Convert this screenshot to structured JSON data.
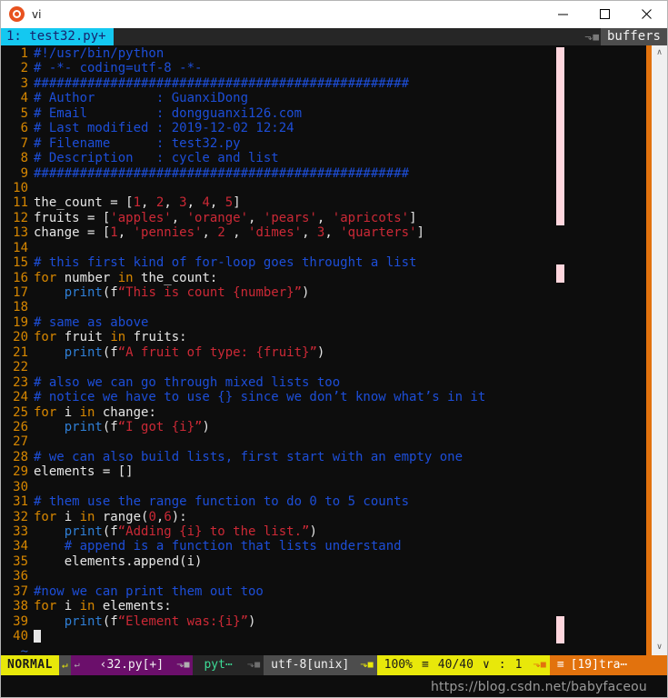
{
  "window": {
    "title": "vi",
    "app_icon": "ubuntu-icon",
    "controls": {
      "minimize": "–",
      "maximize": "□",
      "close": "✕"
    }
  },
  "tabline": {
    "active_tab": "1: test32.py+",
    "separator_glyph": "⬎■",
    "right_label": "buffers"
  },
  "editor": {
    "lines": [
      {
        "n": "1",
        "tokens": [
          {
            "t": "#!/usr/bin/python",
            "c": "c-comment"
          }
        ]
      },
      {
        "n": "2",
        "tokens": [
          {
            "t": "# -*- coding=utf-8 -*-",
            "c": "c-comment"
          }
        ]
      },
      {
        "n": "3",
        "tokens": [
          {
            "t": "#################################################",
            "c": "c-comment"
          }
        ]
      },
      {
        "n": "4",
        "tokens": [
          {
            "t": "# Author        : GuanxiDong",
            "c": "c-comment"
          }
        ]
      },
      {
        "n": "5",
        "tokens": [
          {
            "t": "# Email         : dongguanxi126.com",
            "c": "c-comment"
          }
        ]
      },
      {
        "n": "6",
        "tokens": [
          {
            "t": "# Last modified : 2019-12-02 12:24",
            "c": "c-comment"
          }
        ]
      },
      {
        "n": "7",
        "tokens": [
          {
            "t": "# Filename      : test32.py",
            "c": "c-comment"
          }
        ]
      },
      {
        "n": "8",
        "tokens": [
          {
            "t": "# Description   : cycle and list",
            "c": "c-comment"
          }
        ]
      },
      {
        "n": "9",
        "tokens": [
          {
            "t": "#################################################",
            "c": "c-comment"
          }
        ]
      },
      {
        "n": "10",
        "tokens": []
      },
      {
        "n": "11",
        "tokens": [
          {
            "t": "the_count = [",
            "c": "c-plain"
          },
          {
            "t": "1",
            "c": "c-num"
          },
          {
            "t": ", ",
            "c": "c-plain"
          },
          {
            "t": "2",
            "c": "c-num"
          },
          {
            "t": ", ",
            "c": "c-plain"
          },
          {
            "t": "3",
            "c": "c-num"
          },
          {
            "t": ", ",
            "c": "c-plain"
          },
          {
            "t": "4",
            "c": "c-num"
          },
          {
            "t": ", ",
            "c": "c-plain"
          },
          {
            "t": "5",
            "c": "c-num"
          },
          {
            "t": "]",
            "c": "c-plain"
          }
        ]
      },
      {
        "n": "12",
        "tokens": [
          {
            "t": "fruits = [",
            "c": "c-plain"
          },
          {
            "t": "'apples'",
            "c": "c-str"
          },
          {
            "t": ", ",
            "c": "c-plain"
          },
          {
            "t": "'orange'",
            "c": "c-str"
          },
          {
            "t": ", ",
            "c": "c-plain"
          },
          {
            "t": "'pears'",
            "c": "c-str"
          },
          {
            "t": ", ",
            "c": "c-plain"
          },
          {
            "t": "'apricots'",
            "c": "c-str"
          },
          {
            "t": "]",
            "c": "c-plain"
          }
        ]
      },
      {
        "n": "13",
        "tokens": [
          {
            "t": "change = [",
            "c": "c-plain"
          },
          {
            "t": "1",
            "c": "c-num"
          },
          {
            "t": ", ",
            "c": "c-plain"
          },
          {
            "t": "'pennies'",
            "c": "c-str"
          },
          {
            "t": ", ",
            "c": "c-plain"
          },
          {
            "t": "2",
            "c": "c-num"
          },
          {
            "t": " , ",
            "c": "c-plain"
          },
          {
            "t": "'dimes'",
            "c": "c-str"
          },
          {
            "t": ", ",
            "c": "c-plain"
          },
          {
            "t": "3",
            "c": "c-num"
          },
          {
            "t": ", ",
            "c": "c-plain"
          },
          {
            "t": "'quarters'",
            "c": "c-str"
          },
          {
            "t": "]",
            "c": "c-plain"
          }
        ]
      },
      {
        "n": "14",
        "tokens": []
      },
      {
        "n": "15",
        "tokens": [
          {
            "t": "# this first kind of for-loop goes throught a list",
            "c": "c-comment"
          }
        ]
      },
      {
        "n": "16",
        "tokens": [
          {
            "t": "for",
            "c": "c-kw"
          },
          {
            "t": " number ",
            "c": "c-plain"
          },
          {
            "t": "in",
            "c": "c-kw"
          },
          {
            "t": " the_count:",
            "c": "c-plain"
          }
        ]
      },
      {
        "n": "17",
        "tokens": [
          {
            "t": "    ",
            "c": "c-plain"
          },
          {
            "t": "print",
            "c": "c-fn"
          },
          {
            "t": "(f",
            "c": "c-plain"
          },
          {
            "t": "“This is count {number}”",
            "c": "c-str"
          },
          {
            "t": ")",
            "c": "c-plain"
          }
        ]
      },
      {
        "n": "18",
        "tokens": []
      },
      {
        "n": "19",
        "tokens": [
          {
            "t": "# same as above",
            "c": "c-comment"
          }
        ]
      },
      {
        "n": "20",
        "tokens": [
          {
            "t": "for",
            "c": "c-kw"
          },
          {
            "t": " fruit ",
            "c": "c-plain"
          },
          {
            "t": "in",
            "c": "c-kw"
          },
          {
            "t": " fruits:",
            "c": "c-plain"
          }
        ]
      },
      {
        "n": "21",
        "tokens": [
          {
            "t": "    ",
            "c": "c-plain"
          },
          {
            "t": "print",
            "c": "c-fn"
          },
          {
            "t": "(f",
            "c": "c-plain"
          },
          {
            "t": "“A fruit of type: {fruit}”",
            "c": "c-str"
          },
          {
            "t": ")",
            "c": "c-plain"
          }
        ]
      },
      {
        "n": "22",
        "tokens": []
      },
      {
        "n": "23",
        "tokens": [
          {
            "t": "# also we can go through mixed lists too",
            "c": "c-comment"
          }
        ]
      },
      {
        "n": "24",
        "tokens": [
          {
            "t": "# notice we have to use {} since we don’t know what’s in it",
            "c": "c-comment"
          }
        ]
      },
      {
        "n": "25",
        "tokens": [
          {
            "t": "for",
            "c": "c-kw"
          },
          {
            "t": " i ",
            "c": "c-plain"
          },
          {
            "t": "in",
            "c": "c-kw"
          },
          {
            "t": " change:",
            "c": "c-plain"
          }
        ]
      },
      {
        "n": "26",
        "tokens": [
          {
            "t": "    ",
            "c": "c-plain"
          },
          {
            "t": "print",
            "c": "c-fn"
          },
          {
            "t": "(f",
            "c": "c-plain"
          },
          {
            "t": "“I got {i}”",
            "c": "c-str"
          },
          {
            "t": ")",
            "c": "c-plain"
          }
        ]
      },
      {
        "n": "27",
        "tokens": []
      },
      {
        "n": "28",
        "tokens": [
          {
            "t": "# we can also build lists, first start with an empty one",
            "c": "c-comment"
          }
        ]
      },
      {
        "n": "29",
        "tokens": [
          {
            "t": "elements = []",
            "c": "c-plain"
          }
        ]
      },
      {
        "n": "30",
        "tokens": []
      },
      {
        "n": "31",
        "tokens": [
          {
            "t": "# them use the range function to do 0 to 5 counts",
            "c": "c-comment"
          }
        ]
      },
      {
        "n": "32",
        "tokens": [
          {
            "t": "for",
            "c": "c-kw"
          },
          {
            "t": " i ",
            "c": "c-plain"
          },
          {
            "t": "in",
            "c": "c-kw"
          },
          {
            "t": " range(",
            "c": "c-plain"
          },
          {
            "t": "0",
            "c": "c-num"
          },
          {
            "t": ",",
            "c": "c-plain"
          },
          {
            "t": "6",
            "c": "c-num"
          },
          {
            "t": "):",
            "c": "c-plain"
          }
        ]
      },
      {
        "n": "33",
        "tokens": [
          {
            "t": "    ",
            "c": "c-plain"
          },
          {
            "t": "print",
            "c": "c-fn"
          },
          {
            "t": "(f",
            "c": "c-plain"
          },
          {
            "t": "“Adding {i} to the list.”",
            "c": "c-str"
          },
          {
            "t": ")",
            "c": "c-plain"
          }
        ]
      },
      {
        "n": "34",
        "tokens": [
          {
            "t": "    # append is a function that lists understand",
            "c": "c-comment"
          }
        ]
      },
      {
        "n": "35",
        "tokens": [
          {
            "t": "    elements.append(i)",
            "c": "c-plain"
          }
        ]
      },
      {
        "n": "36",
        "tokens": []
      },
      {
        "n": "37",
        "tokens": [
          {
            "t": "#now we can print them out too",
            "c": "c-comment"
          }
        ]
      },
      {
        "n": "38",
        "tokens": [
          {
            "t": "for",
            "c": "c-kw"
          },
          {
            "t": " i ",
            "c": "c-plain"
          },
          {
            "t": "in",
            "c": "c-kw"
          },
          {
            "t": " elements:",
            "c": "c-plain"
          }
        ]
      },
      {
        "n": "39",
        "tokens": [
          {
            "t": "    ",
            "c": "c-plain"
          },
          {
            "t": "print",
            "c": "c-fn"
          },
          {
            "t": "(f",
            "c": "c-plain"
          },
          {
            "t": "“Element was:{i}”",
            "c": "c-str"
          },
          {
            "t": ")",
            "c": "c-plain"
          }
        ]
      },
      {
        "n": "40",
        "tokens": [],
        "cursor": true
      }
    ],
    "tilde_glyph": "~",
    "tilde_rows": 1
  },
  "statusline": {
    "mode": "NORMAL",
    "mode_arrow": "↵",
    "file_arrow": "↵",
    "filename": "‹32.py[+]",
    "sep_right": "⬎■",
    "filetype": "pyt⋯",
    "encoding": "utf-8[unix]",
    "percent": "100%",
    "lines_icon": "≡",
    "position": "40/40",
    "chevron": "∨",
    "colon": ":",
    "column": "1",
    "tail_icon": "≡",
    "tail_text": "[19]tra⋯"
  },
  "scrollbar": {
    "up_arrow": "∧",
    "down_arrow": "∨"
  },
  "watermark": {
    "text": "https://blog.csdn.net/babyfaceou"
  }
}
